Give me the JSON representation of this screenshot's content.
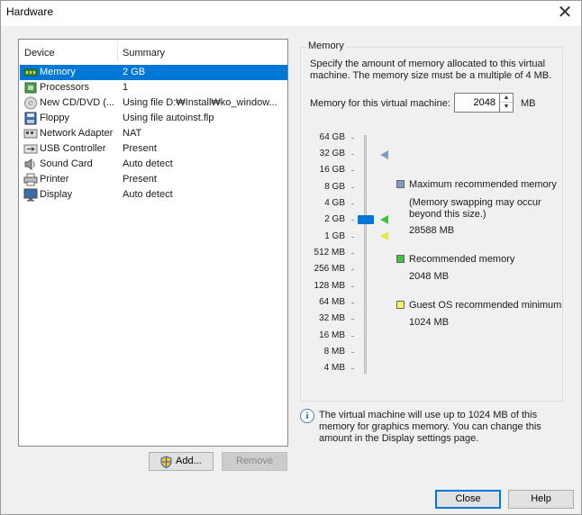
{
  "window": {
    "title": "Hardware",
    "close_glyph": "✕"
  },
  "devices": {
    "col_device": "Device",
    "col_summary": "Summary",
    "rows": [
      {
        "name": "Memory",
        "summary": "2 GB",
        "icon": "memory-icon",
        "selected": true
      },
      {
        "name": "Processors",
        "summary": "1",
        "icon": "processor-icon"
      },
      {
        "name": "New CD/DVD (...",
        "summary": "Using file D:₩Install₩ko_window...",
        "icon": "cd-dvd-icon"
      },
      {
        "name": "Floppy",
        "summary": "Using file autoinst.flp",
        "icon": "floppy-icon"
      },
      {
        "name": "Network Adapter",
        "summary": "NAT",
        "icon": "network-adapter-icon"
      },
      {
        "name": "USB Controller",
        "summary": "Present",
        "icon": "usb-icon"
      },
      {
        "name": "Sound Card",
        "summary": "Auto detect",
        "icon": "sound-card-icon"
      },
      {
        "name": "Printer",
        "summary": "Present",
        "icon": "printer-icon"
      },
      {
        "name": "Display",
        "summary": "Auto detect",
        "icon": "display-icon"
      }
    ]
  },
  "buttons": {
    "add": "Add...",
    "remove": "Remove",
    "close": "Close",
    "help": "Help"
  },
  "memory": {
    "legend": "Memory",
    "description": "Specify the amount of memory allocated to this virtual machine. The memory size must be a multiple of 4 MB.",
    "field_label": "Memory for this virtual machine:",
    "value": "2048",
    "unit": "MB",
    "scale": [
      "64 GB",
      "32 GB",
      "16 GB",
      "8 GB",
      "4 GB",
      "2 GB",
      "1 GB",
      "512 MB",
      "256 MB",
      "128 MB",
      "64 MB",
      "32 MB",
      "16 MB",
      "8 MB",
      "4 MB"
    ],
    "max_recommended": {
      "label": "Maximum recommended memory",
      "note": "(Memory swapping may occur beyond this size.)",
      "value": "28588 MB",
      "color": "#7f9cc7"
    },
    "recommended": {
      "label": "Recommended memory",
      "value": "2048 MB",
      "color": "#3fc43f"
    },
    "guest_min": {
      "label": "Guest OS recommended minimum",
      "value": "1024 MB",
      "color": "#f2f26b"
    },
    "info": "The virtual machine will use up to 1024 MB of this memory for graphics memory. You can change this amount in the Display settings page."
  }
}
